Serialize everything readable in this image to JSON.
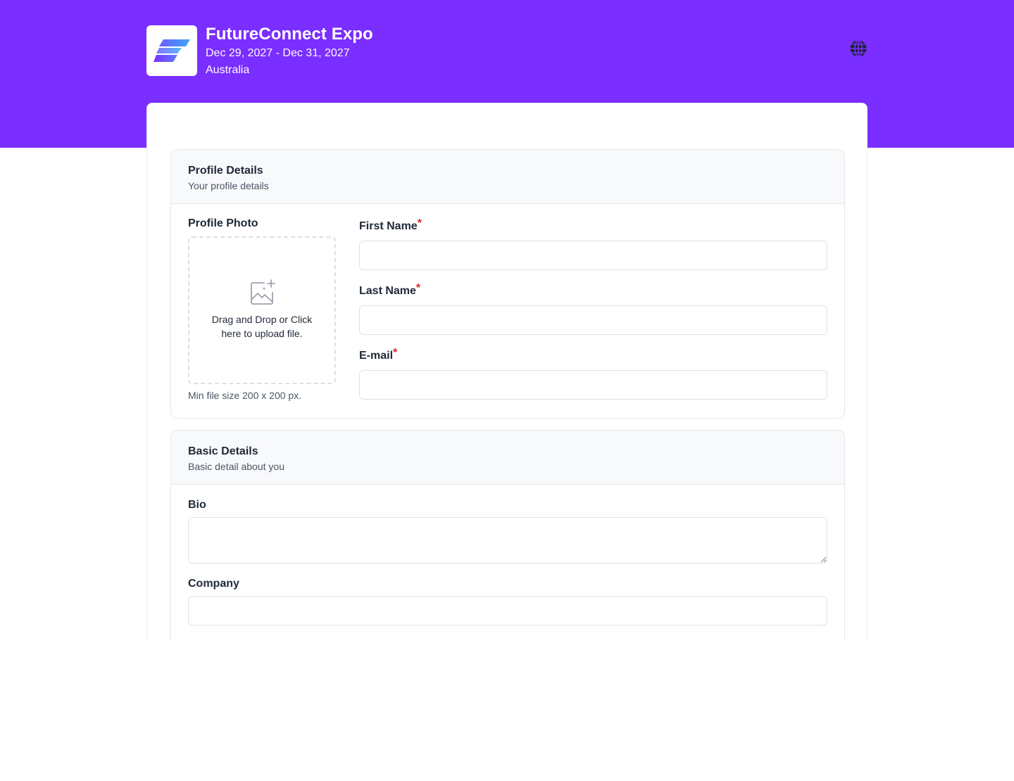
{
  "event": {
    "title": "FutureConnect Expo",
    "dates": "Dec 29, 2027 - Dec 31, 2027",
    "location": "Australia"
  },
  "colors": {
    "brand": "#7a2eff",
    "required": "#dc2626"
  },
  "icons": {
    "logo": "futureconnect-logo",
    "language": "globe-icon",
    "upload": "image-add-icon"
  },
  "profile_section": {
    "title": "Profile Details",
    "subtitle": "Your profile details",
    "photo_label": "Profile Photo",
    "upload_text": "Drag and Drop or Click here to upload file.",
    "upload_hint": "Min file size 200 x 200 px.",
    "fields": [
      {
        "label": "First Name",
        "required": "*",
        "value": ""
      },
      {
        "label": "Last Name",
        "required": "*",
        "value": ""
      },
      {
        "label": "E-mail",
        "required": "*",
        "value": ""
      }
    ]
  },
  "basic_section": {
    "title": "Basic Details",
    "subtitle": "Basic detail about you",
    "bio_label": "Bio",
    "bio_value": "",
    "company_label": "Company",
    "company_value": ""
  }
}
